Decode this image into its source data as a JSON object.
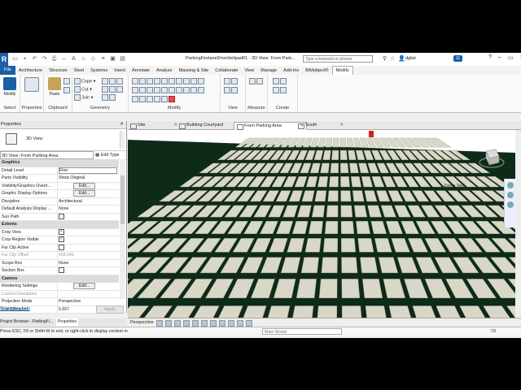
{
  "titlebar": {
    "app_letter": "R",
    "doc_title": "ParkingFirelaneDriveHelipad01 - 3D View: From Park...",
    "search_placeholder": "Type a keyword or phrase",
    "user": "dglist",
    "badge": "11"
  },
  "ribbon_tabs": [
    "File",
    "Architecture",
    "Structure",
    "Steel",
    "Systems",
    "Insert",
    "Annotate",
    "Analyze",
    "Massing & Site",
    "Collaborate",
    "View",
    "Manage",
    "Add-Ins",
    "BIMobject®",
    "Modify"
  ],
  "ribbon": {
    "modify": "Modify",
    "select": "Select",
    "properties": "Properties",
    "paste": "Paste",
    "clipboard": "Clipboard",
    "cope": "Cope",
    "cut": "Cut",
    "join": "Join",
    "geometry": "Geometry",
    "modify_group": "Modify",
    "view": "View",
    "measure": "Measure",
    "create": "Create"
  },
  "properties": {
    "title": "Properties",
    "type_name": "3D View",
    "selector": "3D View: From Parking Area",
    "edit_type": "Edit Type",
    "rows": [
      {
        "k": "Graphics",
        "v": "",
        "kind": "section"
      },
      {
        "k": "Detail Level",
        "v": "Fine",
        "kind": "box"
      },
      {
        "k": "Parts Visibility",
        "v": "Show Original",
        "kind": "text"
      },
      {
        "k": "Visibility/Graphics Overri...",
        "v": "Edit...",
        "kind": "btn"
      },
      {
        "k": "Graphic Display Options",
        "v": "Edit...",
        "kind": "btn"
      },
      {
        "k": "Discipline",
        "v": "Architectural",
        "kind": "text"
      },
      {
        "k": "Default Analysis Display ...",
        "v": "None",
        "kind": "text"
      },
      {
        "k": "Sun Path",
        "v": "",
        "kind": "cb_off"
      },
      {
        "k": "Extents",
        "v": "",
        "kind": "section"
      },
      {
        "k": "Crop View",
        "v": "",
        "kind": "cb_on"
      },
      {
        "k": "Crop Region Visible",
        "v": "",
        "kind": "cb_on"
      },
      {
        "k": "Far Clip Active",
        "v": "",
        "kind": "cb_off"
      },
      {
        "k": "Far Clip Offset",
        "v": "428.045",
        "kind": "grey"
      },
      {
        "k": "Scope Box",
        "v": "None",
        "kind": "text"
      },
      {
        "k": "Section Box",
        "v": "",
        "kind": "cb_off"
      },
      {
        "k": "Camera",
        "v": "",
        "kind": "section"
      },
      {
        "k": "Rendering Settings",
        "v": "Edit...",
        "kind": "btn"
      },
      {
        "k": "Locked Orientation",
        "v": "",
        "kind": "grey"
      },
      {
        "k": "Projection Mode",
        "v": "Perspective",
        "kind": "text"
      },
      {
        "k": "Eye Elevation",
        "v": "5.657",
        "kind": "text"
      }
    ],
    "help": "Properties help",
    "apply": "Apply"
  },
  "bottom_tabs": [
    "Project Browser - ParkingFi...",
    "Properties"
  ],
  "view_tabs": [
    "Site",
    "Building Courtyard",
    "From Parking Area",
    "South"
  ],
  "canvas": {
    "zoom_tool": "Zoom Tool",
    "colors": {
      "sky": "#ffffff",
      "paving": "#0e2a18",
      "tile": "#d9d7c8",
      "highlight": "#cc2222"
    }
  },
  "view_control": {
    "projection": "Perspective"
  },
  "status": {
    "message": "Press ESC, F8 or Shift+W to exit, or right-click to display context m",
    "model": "Main Model",
    "counter": "0"
  }
}
